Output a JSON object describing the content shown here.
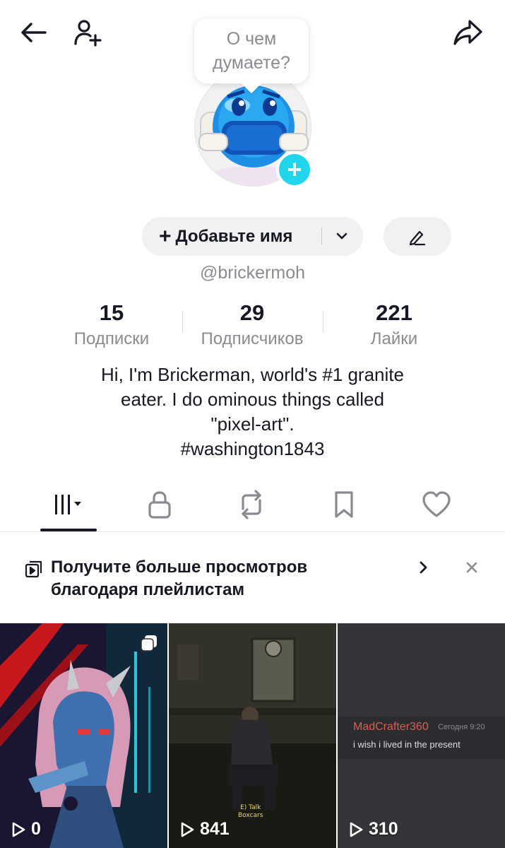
{
  "avatar_tooltip": {
    "line1": "О чем",
    "line2": "думаете?"
  },
  "profile": {
    "add_name_label": "Добавьте имя",
    "add_name_plus": "+",
    "avatar_plus": "+",
    "handle": "@brickermoh"
  },
  "stats": [
    {
      "value": "15",
      "label": "Подписки"
    },
    {
      "value": "29",
      "label": "Подписчиков"
    },
    {
      "value": "221",
      "label": "Лайки"
    }
  ],
  "bio": {
    "line1": "Hi, I'm Brickerman, world's #1 granite",
    "line2": "eater. I do ominous things called",
    "line3": "\"pixel-art\".",
    "line4": "#washington1843"
  },
  "tabs": [
    "videos-grid-icon",
    "lock-icon",
    "repost-icon",
    "bookmark-icon",
    "heart-icon"
  ],
  "promo": {
    "line1": "Получите больше просмотров",
    "line2": "благодаря плейлистам"
  },
  "videos": [
    {
      "views": "0"
    },
    {
      "views": "841",
      "caption_line1": "E) Talk",
      "caption_line2": "Boxcars"
    },
    {
      "views": "310",
      "comment_user": "MadCrafter360",
      "comment_date": "Сегодня 9:20",
      "comment_text": "i wish i lived in the present"
    }
  ],
  "colors": {
    "accent_cyan": "#20d5ec",
    "text_primary": "#161823",
    "text_secondary": "#8a8b91",
    "pill_bg": "#f1f1f2"
  }
}
